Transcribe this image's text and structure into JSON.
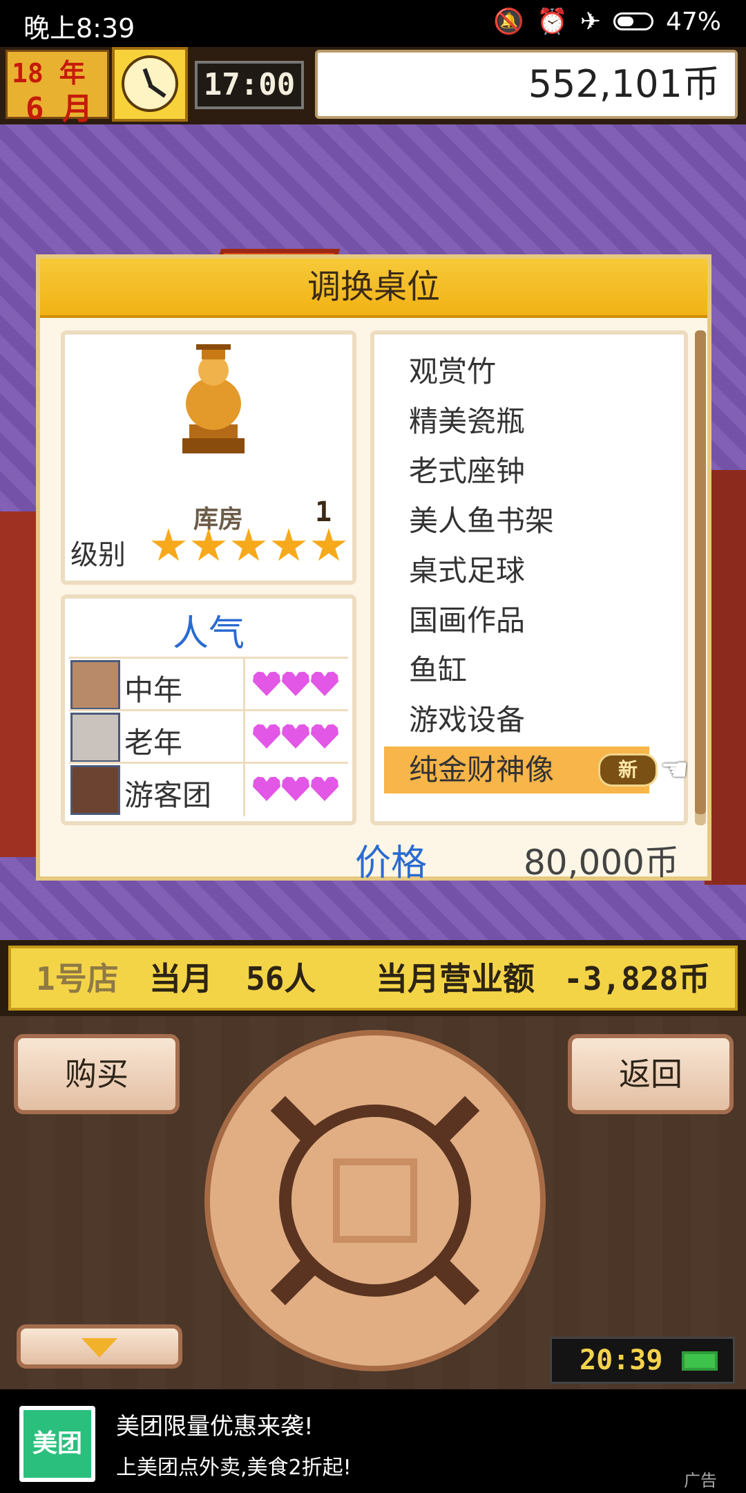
{
  "status_bar": {
    "time": "晚上8:39",
    "battery": "47%"
  },
  "hud": {
    "year": "18 年",
    "month": "6 月",
    "game_time": "17:00",
    "money": "552,101币"
  },
  "dialog": {
    "title": "调换桌位",
    "item": {
      "storage_label": "库房",
      "storage_count": "1",
      "level_label": "级别",
      "stars": 5
    },
    "popularity": {
      "title": "人气",
      "rows": [
        {
          "name": "中年",
          "hearts": 3
        },
        {
          "name": "老年",
          "hearts": 3
        },
        {
          "name": "游客团",
          "hearts": 3
        }
      ]
    },
    "items": [
      "观赏竹",
      "精美瓷瓶",
      "老式座钟",
      "美人鱼书架",
      "桌式足球",
      "国画作品",
      "鱼缸",
      "游戏设备",
      "纯金财神像"
    ],
    "selected_index": 8,
    "new_badge": "新",
    "price_label": "价格",
    "price_value": "80,000币"
  },
  "store_strip": {
    "store": "1号店",
    "month_label": "当月",
    "visitors": "56人",
    "sales_label": "当月营业额",
    "sales_value": "-3,828币"
  },
  "controls": {
    "buy": "购买",
    "back": "返回",
    "clock": "20:39"
  },
  "ad": {
    "logo": "美团",
    "title": "美团限量优惠来袭!",
    "subtitle": "上美团点外卖,美食2折起!",
    "tag": "广告"
  },
  "colors": {
    "accent_blue": "#2a6bd1",
    "selected_row": "#f7b54a",
    "star": "#f7a91c",
    "heart": "#e257e6"
  }
}
